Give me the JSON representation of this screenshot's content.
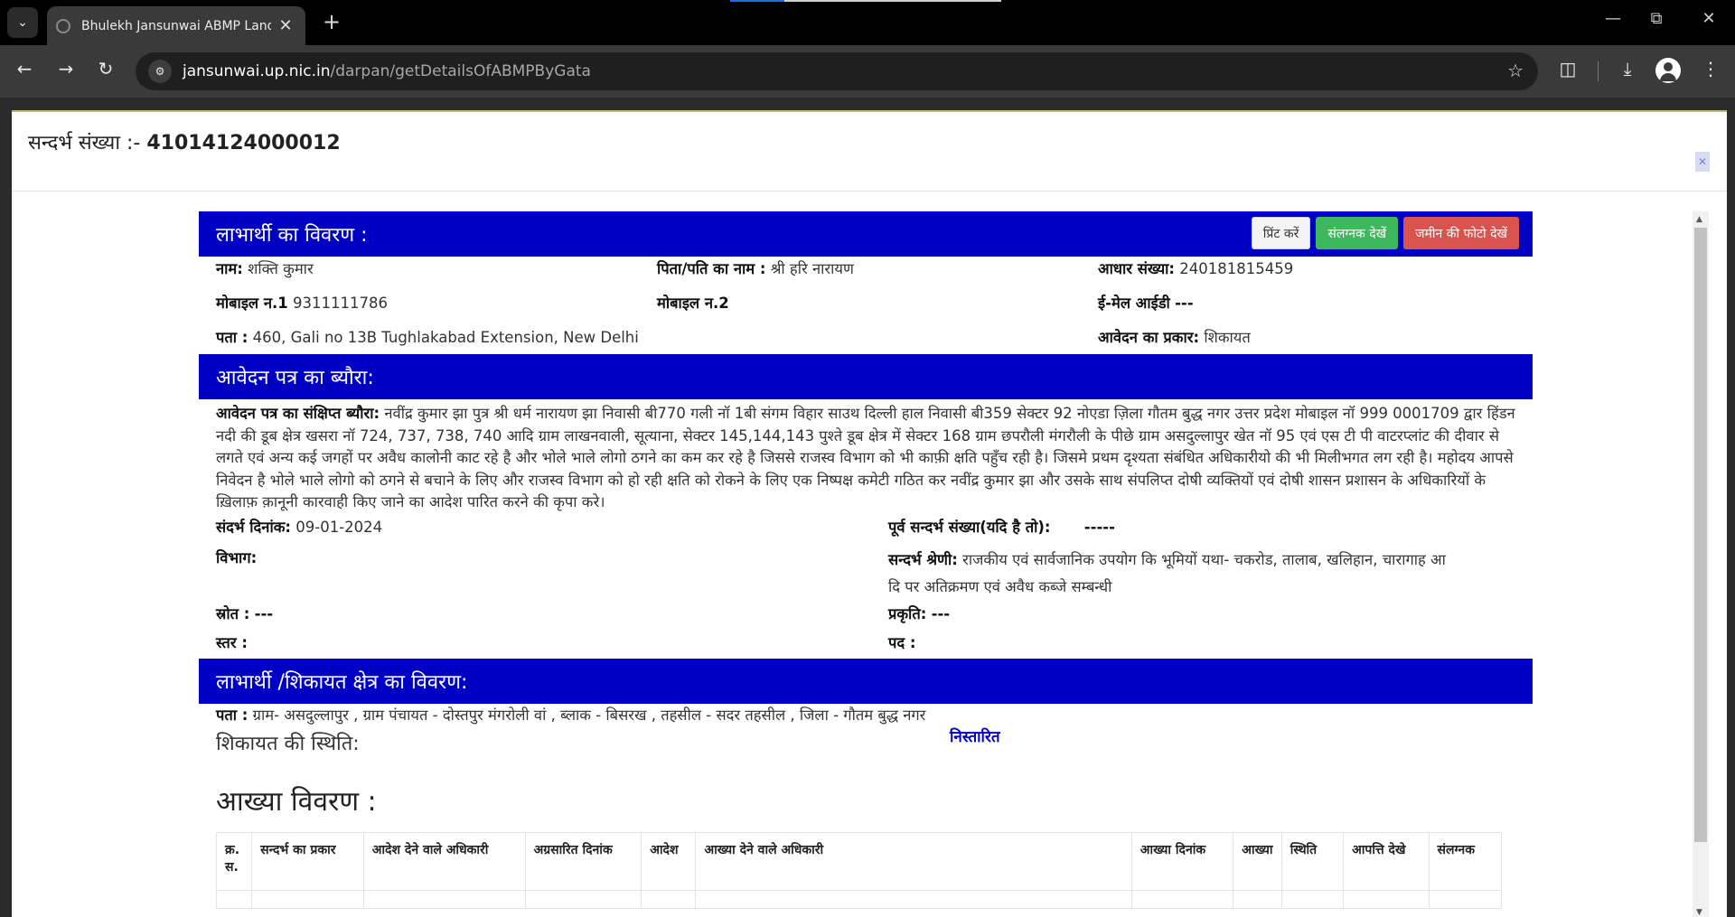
{
  "browser": {
    "tab_title": "Bhulekh Jansunwai ABMP Land",
    "url_host": "jansunwai.up.nic.in",
    "url_path": "/darpan/getDetailsOfABMPByGata"
  },
  "header": {
    "ref_label": "सन्दर्भ संख्या :-",
    "ref_number": "41014124000012"
  },
  "beneficiary": {
    "section_title": "लाभार्थी का विवरण :",
    "buttons": {
      "print": "प्रिंट करें",
      "attachment": "संलग्नक देखें",
      "land_photo": "जमीन की फोटो देखें"
    },
    "name_label": "नाम:",
    "name": "शक्ति कुमार",
    "father_label": "पिता/पति का नाम :",
    "father": "श्री हरि नारायण",
    "aadhaar_label": "आधार संख्या:",
    "aadhaar": "240181815459",
    "mobile1_label": "मोबाइल न.1",
    "mobile1": "9311111786",
    "mobile2_label": "मोबाइल न.2",
    "mobile2": "",
    "email_label": "ई-मेल आईडी",
    "email": "---",
    "address_label": "पता :",
    "address": "460, Gali no 13B Tughlakabad Extension, New Delhi",
    "app_type_label": "आवेदन का प्रकार:",
    "app_type": "शिकायत"
  },
  "application": {
    "section_title": "आवेदन पत्र का ब्यौरा:",
    "summary_label": "आवेदन पत्र का संक्षिप्त ब्यौरा:",
    "summary": "नवींद्र कुमार झा पुत्र श्री धर्म नारायण झा निवासी बी770 गली नॉ 1बी संगम विहार साउथ दिल्ली हाल निवासी बी359 सेक्टर 92 नोएडा ज़िला गौतम बुद्ध नगर उत्तर प्रदेश मोबाइल नॉ 999 0001709 द्वार हिंडन नदी की डूब क्षेत्र खसरा नॉ 724, 737, 738, 740 आदि ग्राम लाखनवाली, सूत्याना, सेक्टर 145,144,143 पुश्ते डूब क्षेत्र में सेक्टर 168 ग्राम छपरौली मंगरौली के पीछे ग्राम असदुल्लापुर खेत नॉ 95 एवं एस टी पी वाटरप्लांट की दीवार से लगते एवं अन्य कई जगहों पर अवैध कालोनी काट रहे है और भोले भाले लोगो ठगने का कम कर रहे है जिससे राजस्व विभाग को भी काफ़ी क्षति पहुँच रही है। जिसमे प्रथम दृश्यता संबंधित अधिकारीयो की भी मिलीभगत लग रही है। महोदय आपसे निवेदन है भोले भाले लोगो को ठगने से बचाने के लिए और राजस्व विभाग को हो रही क्षति को रोकने के लिए एक निष्पक्ष कमेटी गठित कर नवींद्र कुमार झा और उसके साथ संपलिप्त दोषी व्यक्तियों एवं दोषी शासन प्रशासन के अधिकारियों के ख़िलाफ़ क़ानूनी कारवाही किए जाने का आदेश पारित करने की कृपा करे।",
    "date_label": "संदर्भ दिनांक:",
    "date": "09-01-2024",
    "prev_ref_label": "पूर्व सन्दर्भ संख्या(यदि है तो):",
    "prev_ref": "-----",
    "dept_label": "विभाग:",
    "dept": "",
    "category_label": "सन्दर्भ श्रेणी:",
    "category_line1": "राजकीय एवं सार्वजानिक उपयोग कि भूमियों यथा- चकरोड, तालाब, खलिहान, चारागाह आ",
    "category_line2": "दि पर अतिक्रमण एवं अवैध कब्जे सम्बन्धी",
    "source_label": "स्रोत :",
    "source": "---",
    "nature_label": "प्रकृति:",
    "nature": "---",
    "level_label": "स्तर :",
    "level": "",
    "post_label": "पद :",
    "post": ""
  },
  "area": {
    "section_title": "लाभार्थी /शिकायत क्षेत्र का विवरण:",
    "address_label": "पता :",
    "address": "ग्राम- असदुल्लापुर , ग्राम पंचायत - दोस्तपुर मंगरोली वां , ब्लाक - बिसरख , तहसील - सदर तहसील , जिला - गौतम बुद्ध नगर",
    "status_label": "शिकायत की स्थिति:",
    "status_value": "निस्तारित"
  },
  "akhya": {
    "title": "आख्या विवरण :",
    "columns": [
      "क्र. स.",
      "सन्दर्भ का प्रकार",
      "आदेश देने वाले अधिकारी",
      "अग्रसारित दिनांक",
      "आदेश",
      "आख्या देने वाले अधिकारी",
      "आख्या दिनांक",
      "आख्या",
      "स्थिति",
      "आपत्ति देखे",
      "संलग्नक"
    ]
  },
  "colors": {
    "section_blue": "#0000c4",
    "status_blue": "#0000c4",
    "btn_green": "#3fb75d",
    "btn_red": "#d9534f"
  }
}
